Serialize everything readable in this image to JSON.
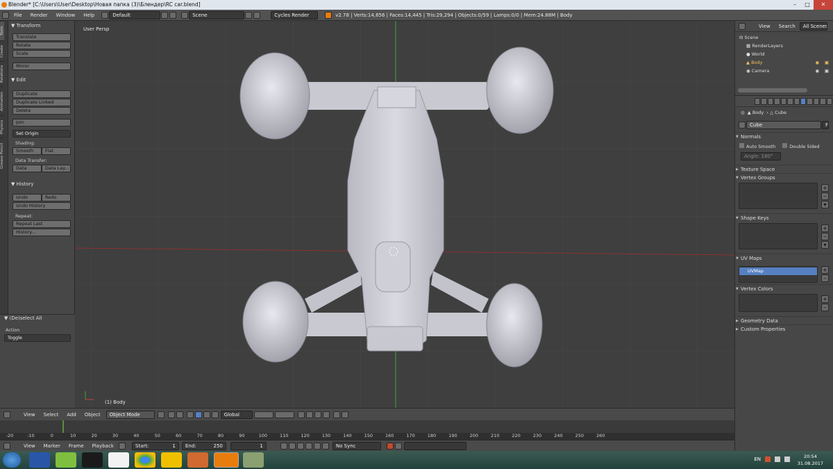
{
  "window": {
    "title": "Blender* [C:\\Users\\User\\Desktop\\Новая папка (3)\\Блендер\\RC car.blend]"
  },
  "menubar": {
    "items": [
      "File",
      "Render",
      "Window",
      "Help"
    ],
    "layout": "Default",
    "scene": "Scene",
    "engine": "Cycles Render",
    "stats": "v2.78 | Verts:14,656 | Faces:14,445 | Tris:29,294 | Objects:0/59 | Lamps:0/0 | Mem:24.88M | Body"
  },
  "toolshelf": {
    "tabs": [
      "Tools",
      "Create",
      "Relations",
      "Animation",
      "Physics",
      "Grease Pencil"
    ],
    "transform": {
      "header": "Transform",
      "buttons": [
        "Translate",
        "Rotate",
        "Scale",
        "Mirror"
      ]
    },
    "edit": {
      "header": "Edit",
      "buttons": [
        "Duplicate",
        "Duplicate Linked",
        "Delete",
        "Join"
      ],
      "set_origin": "Set Origin",
      "shading_label": "Shading:",
      "smooth": "Smooth",
      "flat": "Flat",
      "data_transfer_label": "Data Transfer:",
      "data": "Data",
      "data_layers": "Data Lay..."
    },
    "history": {
      "header": "History",
      "undo": "Undo",
      "redo": "Redo",
      "undo_history": "Undo History",
      "repeat_label": "Repeat:",
      "repeat_last": "Repeat Last",
      "history_btn": "History..."
    },
    "operator": {
      "header": "(De)select All",
      "action_label": "Action",
      "action_value": "Toggle"
    }
  },
  "viewport": {
    "title": "User Persp",
    "object_label": "(1) Body"
  },
  "view_header": {
    "menus": [
      "View",
      "Select",
      "Add",
      "Object"
    ],
    "mode": "Object Mode",
    "orientation": "Global"
  },
  "timeline": {
    "ticks": [
      "-20",
      "-10",
      "0",
      "10",
      "20",
      "30",
      "40",
      "50",
      "60",
      "70",
      "80",
      "90",
      "100",
      "110",
      "120",
      "130",
      "140",
      "150",
      "160",
      "170",
      "180",
      "190",
      "200",
      "210",
      "220",
      "230",
      "240",
      "250",
      "260"
    ],
    "current_frame": 1,
    "menus": [
      "View",
      "Marker",
      "Frame",
      "Playback"
    ],
    "start_label": "Start:",
    "start": "1",
    "end_label": "End:",
    "end": "250",
    "frame": "1",
    "sync": "No Sync"
  },
  "outliner": {
    "tabs": [
      "View",
      "Search",
      "All Scenes"
    ],
    "items": [
      "Scene",
      "RenderLayers",
      "World",
      "Body",
      "Camera"
    ]
  },
  "properties": {
    "breadcrumb_body": "Body",
    "breadcrumb_cube": "Cube",
    "mesh_name": "Cube",
    "fake_user": "F",
    "normals": {
      "header": "Normals",
      "auto_smooth": "Auto Smooth",
      "double_sided": "Double Sided",
      "angle": "Angle: 180°"
    },
    "texture_space": "Texture Space",
    "vertex_groups": "Vertex Groups",
    "shape_keys": "Shape Keys",
    "uv_maps": "UV Maps",
    "uv_map_item": "UVMap",
    "vertex_colors": "Vertex Colors",
    "geometry_data": "Geometry Data",
    "custom_properties": "Custom Properties"
  },
  "taskbar": {
    "lang": "EN",
    "time": "20:54",
    "date": "31.08.2017"
  },
  "colors": {
    "accent": "#5680c2",
    "blender_orange": "#e87d0d",
    "x_axis": "#a02c2c",
    "y_axis": "#3fa03f"
  }
}
